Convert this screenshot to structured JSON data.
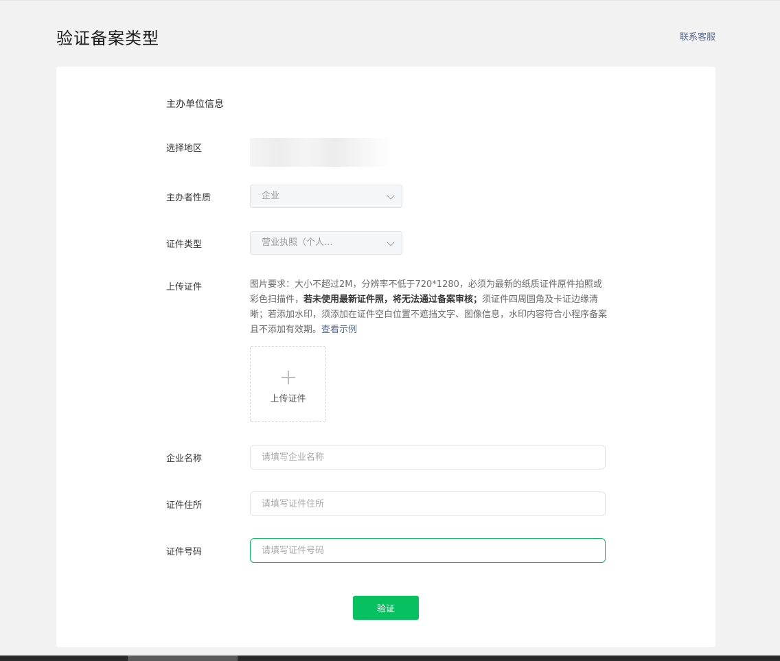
{
  "header": {
    "title": "验证备案类型",
    "support_link": "联系客服"
  },
  "form": {
    "section_title": "主办单位信息",
    "region_label": "选择地区",
    "nature_label": "主办者性质",
    "nature_value": "企业",
    "cert_type_label": "证件类型",
    "cert_type_value": "营业执照（个人...",
    "upload_label": "上传证件",
    "upload_desc_1": "图片要求：大小不超过2M，分辨率不低于720*1280，必须为最新的纸质证件原件拍照或彩色扫描件，",
    "upload_desc_bold": "若未使用最新证件照，将无法通过备案审核；",
    "upload_desc_2": "须证件四周圆角及卡证边缘清晰；若添加水印，须添加在证件空白位置不遮挡文字、图像信息，水印内容符合小程序备案且不添加有效期。",
    "view_example": "查看示例",
    "upload_button": "上传证件",
    "company_name_label": "企业名称",
    "company_name_placeholder": "请填写企业名称",
    "cert_address_label": "证件住所",
    "cert_address_placeholder": "请填写证件住所",
    "cert_number_label": "证件号码",
    "cert_number_placeholder": "请填写证件号码",
    "submit": "验证"
  },
  "colors": {
    "primary": "#07c160",
    "link": "#576b95",
    "background": "#f2f2f2"
  }
}
